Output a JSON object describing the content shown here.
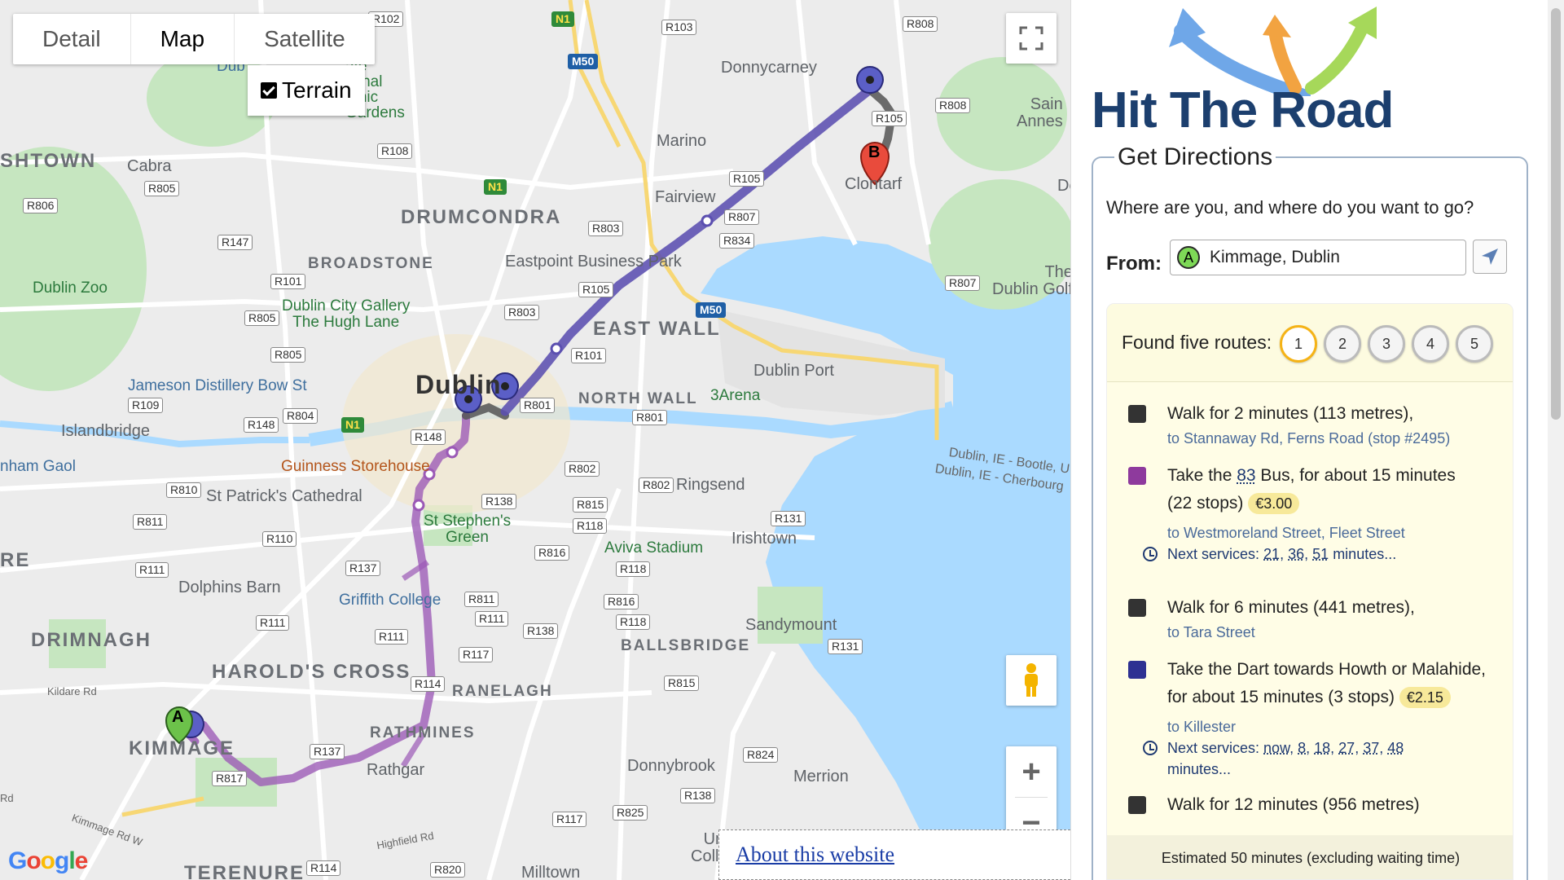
{
  "map": {
    "types": [
      "Detail",
      "Map",
      "Satellite"
    ],
    "active_type": "Map",
    "terrain_label": "Terrain",
    "terrain_checked": true,
    "about_link": "About this website",
    "google_logo": "Google",
    "labels": {
      "donnycarney": "Donnycarney",
      "marino": "Marino",
      "fairview": "Fairview",
      "clontarf": "Clontarf",
      "drumcondra": "DRUMCONDRA",
      "broadstone": "BROADSTONE",
      "cabra": "Cabra",
      "shtown": "SHTOWN",
      "dublin_zoo": "Dublin Zoo",
      "gallery": "Dublin City Gallery\nThe Hugh Lane",
      "eastpoint": "Eastpoint Business Park",
      "east_wall": "EAST WALL",
      "dublin": "Dublin",
      "north_wall": "NORTH WALL",
      "arena": "3Arena",
      "dublin_port": "Dublin Port",
      "dublin_golf": "The\nDublin Golf",
      "jameson": "Jameson Distillery Bow St",
      "islandbridge": "Islandbridge",
      "ham_gaol": "nham Gaol",
      "guinness": "Guinness Storehouse",
      "patricks": "St Patrick's Cathedral",
      "ringsend": "Ringsend",
      "ferry1": "Dublin, IE - Bootle, U",
      "ferry2": "Dublin, IE - Cherbourg",
      "stephens": "St Stephen's\nGreen",
      "aviva": "Aviva Stadium",
      "irishtown": "Irishtown",
      "dolphins": "Dolphins Barn",
      "griffith": "Griffith College",
      "drimnagh": "DRIMNAGH",
      "harolds": "HAROLD'S CROSS",
      "ranelagh": "RANELAGH",
      "ballsbridge": "BALLSBRIDGE",
      "sandymount": "Sandymount",
      "rathmines": "RATHMINES",
      "rathgar": "Rathgar",
      "kimmage": "KIMMAGE",
      "donnybrook": "Donnybrook",
      "merrion": "Merrion",
      "terenure": "TERENURE",
      "milltown": "Milltown",
      "sainte": "Sain\nAnnes",
      "re": "RE",
      "botanic": "ate\ntional\ntanic\nGardens",
      "dub": "Dub",
      "kildare": "Kildare Rd",
      "kimmage_rd": "Kimmage Rd W",
      "highfield": "Highfield Rd",
      "uni": "Uni\nColle",
      "de": "De",
      "rd": "Rd"
    },
    "roads": [
      "R102",
      "R103",
      "R808",
      "M50",
      "N1",
      "R105",
      "R108",
      "R805",
      "R806",
      "R107",
      "R834",
      "R803",
      "R147",
      "R101",
      "R105b",
      "R807",
      "R805b",
      "R803b",
      "R805c",
      "M50b",
      "R101b",
      "R109",
      "R804",
      "N1b",
      "R148",
      "R801",
      "R801b",
      "R148b",
      "R810",
      "R802",
      "R138",
      "R815",
      "R118",
      "R131",
      "R811",
      "R110",
      "R137",
      "R816",
      "R118b",
      "R111",
      "R811b",
      "R111b",
      "R111c",
      "R138b",
      "R816b",
      "R118c",
      "R131b",
      "R117",
      "R114",
      "R815b",
      "R137b",
      "R817",
      "R824",
      "R138c",
      "R825",
      "R117b",
      "R114b",
      "R820"
    ],
    "road_labels": {
      "R102": "R102",
      "R103": "R103",
      "R808": "R808",
      "M50": "M50",
      "N1": "N1",
      "R105": "R105",
      "R108": "R108",
      "R805": "R805",
      "R806": "R806",
      "R107": "R807",
      "R834": "R834",
      "R803": "R803",
      "R147": "R147",
      "R101": "R101",
      "R105b": "R105",
      "R807": "R807",
      "R805b": "R805",
      "R803b": "R803",
      "R805c": "R805",
      "M50b": "M50",
      "R101b": "R101",
      "R109": "R109",
      "R804": "R804",
      "N1b": "N1",
      "R148": "R148",
      "R801": "R801",
      "R801b": "R801",
      "R148b": "R148",
      "R810": "R810",
      "R802": "R802",
      "R138": "R138",
      "R815": "R815",
      "R118": "R118",
      "R131": "R131",
      "R811": "R811",
      "R110": "R110",
      "R137": "R137",
      "R816": "R816",
      "R118b": "R118",
      "R111": "R111",
      "R811b": "R811",
      "R111b": "R111",
      "R111c": "R111",
      "R138b": "R138",
      "R816b": "R816",
      "R118c": "R118",
      "R131b": "R131",
      "R117": "R117",
      "R114": "R114",
      "R815b": "R815",
      "R137b": "R137",
      "R817": "R817",
      "R824": "R824",
      "R138c": "R138",
      "R825": "R825",
      "R117b": "R117",
      "R114b": "R114",
      "R820": "R820",
      "R808b": "R808"
    },
    "marker_a": "A",
    "marker_b": "B"
  },
  "sidebar": {
    "app_title": "Hit The Road",
    "legend": "Get Directions",
    "question": "Where are you, and where do you want to go?",
    "from_label": "From:",
    "from_badge": "A",
    "from_value": "Kimmage, Dublin",
    "found_text": "Found five routes:",
    "routes": [
      "1",
      "2",
      "3",
      "4",
      "5"
    ],
    "active_route": "1",
    "steps": [
      {
        "color": "#333333",
        "text": "Walk for 2 minutes (113 metres),",
        "sub": "to Stannaway Rd, Ferns Road (stop #2495)"
      },
      {
        "color": "#8e3a9d",
        "text_pre": "Take the ",
        "route": "83",
        "text_post": " Bus, for about 15 minutes",
        "text2": "(22 stops)",
        "price": "€3.00",
        "sub": "to Westmoreland Street, Fleet Street",
        "next_label": "Next services:",
        "next": [
          "21",
          "36",
          "51"
        ],
        "next_suffix": "minutes..."
      },
      {
        "color": "#333333",
        "text": "Walk for 6 minutes (441 metres),",
        "sub": "to Tara Street"
      },
      {
        "color": "#2e3192",
        "text": "Take the Dart towards Howth or Malahide,",
        "text2": "for about 15 minutes (3 stops)",
        "price": "€2.15",
        "sub": "to Killester",
        "next_label": "Next services:",
        "next": [
          "now",
          "8",
          "18",
          "27",
          "37",
          "48"
        ],
        "next_suffix": "minutes..."
      },
      {
        "color": "#333333",
        "text": "Walk for 12 minutes (956 metres)"
      }
    ],
    "estimate": "Estimated 50 minutes (excluding waiting time)"
  },
  "colors": {
    "bus_route": "#9b59b6",
    "dart_route": "#5b4fb0",
    "walk_route": "#555555",
    "accent": "#f5b316",
    "title": "#1c3f6e"
  }
}
